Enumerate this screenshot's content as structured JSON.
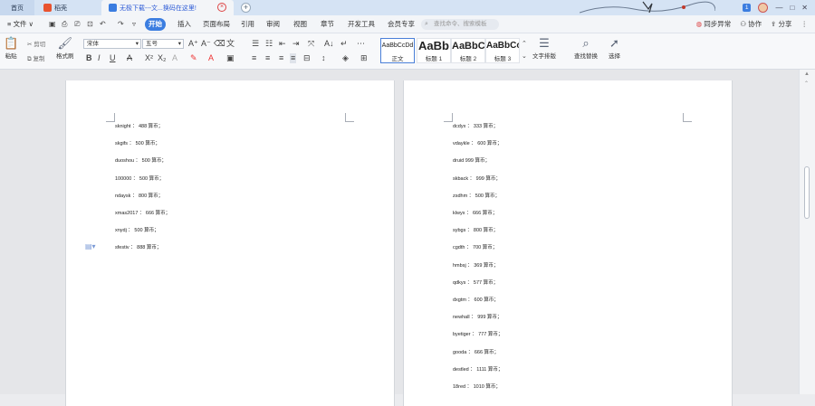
{
  "tabs": {
    "home": "首页",
    "docer": "稻壳",
    "document": "无极下载---文...换码在这里!"
  },
  "title_right": {
    "badge": "1",
    "min": "—",
    "max": "□",
    "close": "✕"
  },
  "menu": {
    "file": "≡ 文件 ∨",
    "items": [
      "开始",
      "插入",
      "页面布局",
      "引用",
      "审阅",
      "视图",
      "章节",
      "开发工具",
      "会员专享"
    ],
    "search_placeholder": "查找命令、搜索模板",
    "right": {
      "sync": "同步异常",
      "collab": "协作",
      "share": "分享"
    }
  },
  "ribbon": {
    "paste": "粘贴",
    "cut": "剪切",
    "copy": "复制",
    "format_painter": "格式刷",
    "font_name": "宋体",
    "font_size": "五号",
    "styles": {
      "normal_sample": "AaBbCcDd",
      "normal": "正文",
      "h1_sample": "AaBb",
      "h1": "标题 1",
      "h2_sample": "AaBbC",
      "h2": "标题 2",
      "h3_sample": "AaBbCc",
      "h3": "标题 3"
    },
    "text_layout": "文字排版",
    "find_replace": "查找替换",
    "select": "选择"
  },
  "colors": {
    "accent": "#3b7de0",
    "tab_bar": "#d5e3f4",
    "docer_logo": "#e8532f"
  },
  "page_left": [
    "sknight ： 488 算币；",
    "skgifs ： 500 算币；",
    "duoshou ： 500 算币；",
    "100000 ： 500 算币；",
    "ndaysk ： 800 算币；",
    "xmas2017 ： 666 算币；",
    "xnydj ： 500 算币；",
    "sfestiv ： 888 算币；"
  ],
  "page_right": [
    "dcdyx ： 333 算币；",
    "vdaykle ： 600 算币；",
    "druid 999 算币；",
    "skback ： 999 算币；",
    "zsdhm ： 500 算币；",
    "klwyx ： 666 算币；",
    "sybgs ： 800 算币；",
    "cgdth ： 700 算币；",
    "hmbsj ： 369 算币；",
    "qdkys ： 577 算币；",
    "dxgtm ： 600 算币；",
    "newhall ： 999 算币；",
    "byetiger ： 777 算币；",
    "gooda ： 666 算币；",
    "destled ： 1111 算币；",
    "18red ： 1010 算币；"
  ]
}
